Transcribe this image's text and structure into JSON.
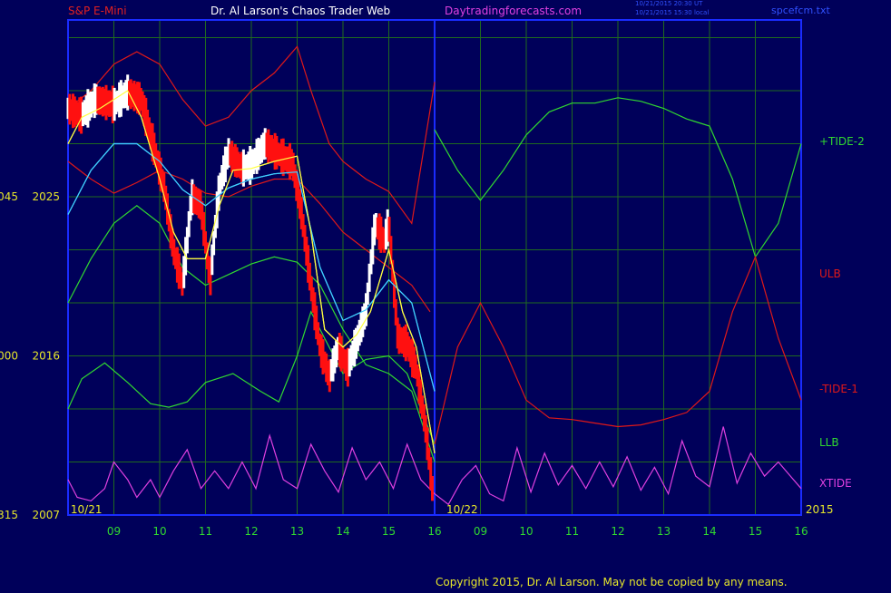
{
  "header": {
    "symbol": "S&P E-Mini",
    "title": "Dr. Al Larson's Chaos Trader Web",
    "site": "Daytradingforecasts.com",
    "timestamp_1": "10/21/2015 20:30 UT",
    "timestamp_2": "10/21/2015 15:30 local",
    "file": "spcefcm.txt"
  },
  "footer": {
    "copyright": "Copyright 2015, Dr. Al Larson. May not be copied by any means."
  },
  "colors": {
    "background": "#00005a",
    "grid": "#1f6a1f",
    "axis": "#1a2cff",
    "ulb": "#e01818",
    "llb": "#30d830",
    "tide_plus": "#30d830",
    "tide_minus": "#e01818",
    "xtide": "#e040e0",
    "price_up": "#ffffff",
    "price_down": "#ff1010",
    "ma_fast": "#ffff40",
    "ma_slow": "#40d0ff"
  },
  "chart_data": {
    "type": "line",
    "y_axis_labels": [
      {
        "left": "045",
        "price": "2025",
        "value": 2025
      },
      {
        "left": "000",
        "price": "2016",
        "value": 2016
      },
      {
        "left": "315",
        "price": "2007",
        "value": 2007
      }
    ],
    "ylim": [
      2007,
      2035
    ],
    "x_tick_labels": [
      "09",
      "10",
      "11",
      "12",
      "13",
      "14",
      "15",
      "16",
      "09",
      "10",
      "11",
      "12",
      "13",
      "14",
      "15",
      "16"
    ],
    "x_hours": [
      9,
      10,
      11,
      12,
      13,
      14,
      15,
      16,
      17,
      18,
      19,
      20,
      21,
      22,
      23,
      24
    ],
    "xlim": [
      8,
      24
    ],
    "date_labels": [
      {
        "label": "10/21",
        "x": 8.4
      },
      {
        "label": "10/22",
        "x": 16.6
      },
      {
        "label": "2015",
        "x": 24.4
      }
    ],
    "now_x": 16,
    "legend_labels": [
      {
        "label": "+TIDE-2",
        "series": "tide_plus"
      },
      {
        "label": "ULB",
        "series": "ulb"
      },
      {
        "label": "-TIDE-1",
        "series": "tide_minus"
      },
      {
        "label": "LLB",
        "series": "llb"
      },
      {
        "label": "XTIDE",
        "series": "xtide"
      }
    ],
    "series": [
      {
        "key": "ulb",
        "color": "ulb",
        "x": [
          8,
          8.5,
          9,
          9.5,
          10,
          10.5,
          11,
          11.5,
          12,
          12.5,
          13,
          13.3,
          13.7,
          14,
          14.5,
          15,
          15.5,
          16
        ],
        "y": [
          2030,
          2031,
          2032.5,
          2033.2,
          2032.5,
          2030.5,
          2029,
          2029.5,
          2031,
          2032,
          2033.5,
          2031,
          2028,
          2027,
          2026,
          2025.3,
          2023.5,
          2031.5
        ]
      },
      {
        "key": "ulb_lower",
        "color": "ulb",
        "x": [
          8,
          8.5,
          9,
          9.5,
          10,
          10.5,
          11,
          11.5,
          12,
          12.5,
          13,
          13.5,
          14,
          14.5,
          15,
          15.5,
          15.9
        ],
        "y": [
          2027,
          2026,
          2025.2,
          2025.8,
          2026.5,
          2026,
          2025.2,
          2025,
          2025.6,
          2026,
          2026,
          2024.6,
          2023,
          2022,
          2021,
          2020,
          2018.5
        ]
      },
      {
        "key": "llb",
        "color": "llb",
        "x": [
          8,
          8.5,
          9,
          9.5,
          10,
          10.5,
          11,
          11.5,
          12,
          12.5,
          13,
          13.5,
          14,
          14.5,
          15,
          15.5,
          16
        ],
        "y": [
          2019,
          2021.5,
          2023.5,
          2024.5,
          2023.5,
          2021,
          2020,
          2020.6,
          2021.2,
          2021.6,
          2021.3,
          2020,
          2017.5,
          2015.5,
          2015,
          2014,
          2010
        ]
      },
      {
        "key": "llb_lower",
        "color": "llb",
        "x": [
          8,
          8.3,
          8.8,
          9.3,
          9.8,
          10.2,
          10.6,
          11,
          11.6,
          12.2,
          12.6,
          13,
          13.3,
          13.7,
          14,
          14.5,
          15,
          15.4,
          16
        ],
        "y": [
          2013,
          2014.7,
          2015.6,
          2014.5,
          2013.3,
          2013.1,
          2013.4,
          2014.5,
          2015,
          2014,
          2013.4,
          2016,
          2018.5,
          2016.5,
          2015,
          2015.8,
          2016,
          2015,
          2011
        ]
      },
      {
        "key": "tide_plus",
        "color": "tide_plus",
        "x": [
          16,
          16.5,
          17,
          17.5,
          18,
          18.5,
          19,
          19.5,
          20,
          20.5,
          21,
          21.5,
          22,
          22.5,
          23,
          23.5,
          24
        ],
        "y": [
          2028.8,
          2026.5,
          2024.8,
          2026.5,
          2028.5,
          2029.8,
          2030.3,
          2030.3,
          2030.6,
          2030.4,
          2030,
          2029.4,
          2029,
          2026,
          2021.6,
          2023.5,
          2028
        ]
      },
      {
        "key": "tide_minus",
        "color": "tide_minus",
        "x": [
          16,
          16.5,
          17,
          17.5,
          18,
          18.5,
          19,
          19.5,
          20,
          20.5,
          21,
          21.5,
          22,
          22.5,
          23,
          23.5,
          24
        ],
        "y": [
          2011,
          2016.5,
          2019,
          2016.5,
          2013.5,
          2012.5,
          2012.4,
          2012.2,
          2012,
          2012.1,
          2012.4,
          2012.8,
          2014,
          2018.5,
          2021.6,
          2017,
          2013.5
        ]
      },
      {
        "key": "xtide",
        "color": "xtide",
        "x": [
          8,
          8.2,
          8.5,
          8.8,
          9,
          9.3,
          9.5,
          9.8,
          10,
          10.3,
          10.6,
          10.9,
          11.2,
          11.5,
          11.8,
          12.1,
          12.4,
          12.7,
          13,
          13.3,
          13.6,
          13.9,
          14.2,
          14.5,
          14.8,
          15.1,
          15.4,
          15.7,
          16,
          16.3,
          16.6,
          16.9,
          17.2,
          17.5,
          17.8,
          18.1,
          18.4,
          18.7,
          19,
          19.3,
          19.6,
          19.9,
          20.2,
          20.5,
          20.8,
          21.1,
          21.4,
          21.7,
          22,
          22.3,
          22.6,
          22.9,
          23.2,
          23.5,
          23.8,
          24
        ],
        "y": [
          2009,
          2008,
          2007.8,
          2008.5,
          2010,
          2009,
          2008,
          2009,
          2008,
          2009.5,
          2010.7,
          2008.5,
          2009.5,
          2008.5,
          2010,
          2008.5,
          2011.5,
          2009,
          2008.5,
          2011,
          2009.5,
          2008.3,
          2010.8,
          2009,
          2010,
          2008.5,
          2011,
          2009,
          2008.2,
          2007.6,
          2009,
          2009.8,
          2008.2,
          2007.8,
          2010.8,
          2008.3,
          2010.5,
          2008.7,
          2009.8,
          2008.5,
          2010,
          2008.6,
          2010.3,
          2008.4,
          2009.7,
          2008.2,
          2011.2,
          2009.2,
          2008.6,
          2012,
          2008.8,
          2010.5,
          2009.2,
          2010,
          2009.1,
          2008.5
        ]
      },
      {
        "key": "ma_slow",
        "color": "ma_slow",
        "x": [
          8,
          8.5,
          9,
          9.5,
          10,
          10.5,
          11,
          11.5,
          12,
          12.5,
          13,
          13.5,
          14,
          14.5,
          15,
          15.5,
          16
        ],
        "y": [
          2024,
          2026.5,
          2028,
          2028,
          2027,
          2025.4,
          2024.5,
          2025.5,
          2026,
          2026.3,
          2026.4,
          2021,
          2018,
          2018.6,
          2020.3,
          2019,
          2014
        ]
      },
      {
        "key": "ma_fast",
        "color": "ma_fast",
        "x": [
          8,
          8.3,
          8.7,
          9,
          9.3,
          9.6,
          10,
          10.3,
          10.6,
          11,
          11.3,
          11.6,
          12,
          12.5,
          13,
          13.3,
          13.6,
          14,
          14.3,
          14.6,
          15,
          15.3,
          15.6,
          16
        ],
        "y": [
          2028,
          2029.5,
          2030,
          2030.5,
          2031,
          2029.5,
          2026,
          2023,
          2021.5,
          2021.5,
          2024.5,
          2026.5,
          2026.6,
          2027,
          2027.3,
          2023,
          2017.5,
          2016.5,
          2017.2,
          2018.5,
          2022,
          2018.5,
          2016.5,
          2010.5
        ]
      },
      {
        "key": "price",
        "color": "price_up",
        "x": [
          8,
          8.3,
          8.6,
          9,
          9.3,
          9.6,
          9.9,
          10.1,
          10.3,
          10.5,
          10.7,
          10.9,
          11.1,
          11.3,
          11.5,
          11.8,
          12,
          12.3,
          12.6,
          12.9,
          13.1,
          13.3,
          13.5,
          13.7,
          13.9,
          14.1,
          14.3,
          14.5,
          14.7,
          14.9,
          15,
          15.2,
          15.4,
          15.6,
          15.8,
          15.95
        ],
        "y": [
          2030,
          2029.6,
          2030.5,
          2030.2,
          2030.9,
          2030.5,
          2027.5,
          2025.5,
          2022,
          2020,
          2025,
          2024.5,
          2020.3,
          2025.5,
          2027.5,
          2026.6,
          2026.8,
          2028,
          2027.4,
          2026.9,
          2024,
          2020,
          2016.5,
          2014.8,
          2016.5,
          2015.3,
          2016.8,
          2018.5,
          2023.5,
          2022.5,
          2023.5,
          2017,
          2016.7,
          2015.3,
          2012,
          2008.5
        ]
      }
    ]
  }
}
